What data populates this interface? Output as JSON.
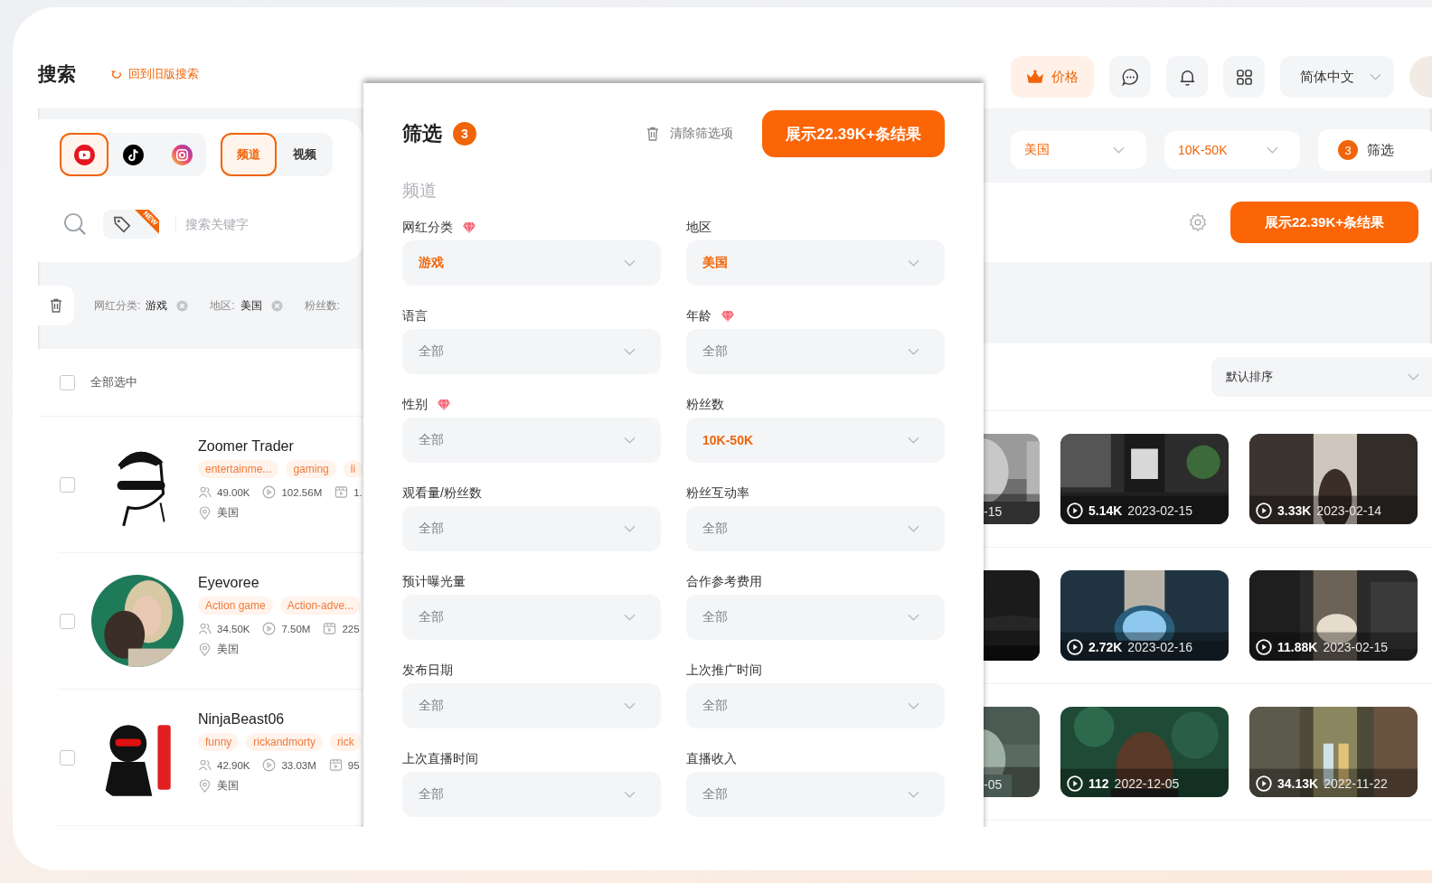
{
  "header": {
    "title": "搜索",
    "back_link": "回到旧版搜索",
    "price_button": "价格",
    "language": "简体中文"
  },
  "platforms": [
    {
      "kind": "youtube",
      "selected": true
    },
    {
      "kind": "tiktok",
      "selected": false
    },
    {
      "kind": "instagram",
      "selected": false
    }
  ],
  "content_types": [
    {
      "label": "频道",
      "selected": true
    },
    {
      "label": "视频",
      "selected": false
    }
  ],
  "search": {
    "tag_badge": "NEW",
    "placeholder": "搜索关键字"
  },
  "quick_filters": [
    {
      "value": "美国"
    },
    {
      "value": "10K-50K"
    }
  ],
  "filter_button": {
    "count": "3",
    "label": "筛选"
  },
  "results_button": "展示22.39K+条结果",
  "active_filters": [
    {
      "label": "网红分类:",
      "value": "游戏"
    },
    {
      "label": "地区:",
      "value": "美国"
    },
    {
      "label": "粉丝数:"
    }
  ],
  "select_all": {
    "label": "全部选中",
    "checked": false
  },
  "sort": "默认排序",
  "creators": [
    {
      "name": "Zoomer Trader",
      "checked": false,
      "tags": [
        "entertainme...",
        "gaming",
        "li"
      ],
      "followers": "49.00K",
      "views": "102.56M",
      "videos": "1.",
      "location": "美国",
      "clips": [
        {
          "kind": "picture",
          "date": "-15"
        },
        {
          "kind": "picture",
          "views": "5.14K",
          "date": "2023-02-15"
        },
        {
          "kind": "picture",
          "views": "3.33K",
          "date": "2023-02-14"
        }
      ]
    },
    {
      "name": "Eyevoree",
      "checked": false,
      "tags": [
        "Action game",
        "Action-adve..."
      ],
      "followers": "34.50K",
      "views": "7.50M",
      "videos": "225",
      "location": "美国",
      "clips": [
        {
          "kind": "picture"
        },
        {
          "kind": "picture",
          "views": "2.72K",
          "date": "2023-02-16"
        },
        {
          "kind": "picture",
          "views": "11.88K",
          "date": "2023-02-15"
        }
      ]
    },
    {
      "name": "NinjaBeast06",
      "checked": false,
      "tags": [
        "funny",
        "rickandmorty",
        "rick"
      ],
      "followers": "42.90K",
      "views": "33.03M",
      "videos": "95",
      "location": "美国",
      "clips": [
        {
          "kind": "picture",
          "date": "-05"
        },
        {
          "kind": "picture",
          "views": "112",
          "date": "2022-12-05"
        },
        {
          "kind": "picture",
          "views": "34.13K",
          "date": "2022-11-22"
        }
      ]
    }
  ],
  "filter_panel": {
    "title": "筛选",
    "count": "3",
    "clear": "清除筛选项",
    "apply": "展示22.39K+条结果",
    "section": "频道",
    "fields": [
      {
        "label": "网红分类",
        "premium": true,
        "value": "游戏",
        "active": true
      },
      {
        "label": "地区",
        "premium": false,
        "value": "美国",
        "active": true
      },
      {
        "label": "语言",
        "premium": false,
        "value": "全部",
        "active": false
      },
      {
        "label": "年龄",
        "premium": true,
        "value": "全部",
        "active": false
      },
      {
        "label": "性别",
        "premium": true,
        "value": "全部",
        "active": false
      },
      {
        "label": "粉丝数",
        "premium": false,
        "value": "10K-50K",
        "active": true
      },
      {
        "label": "观看量/粉丝数",
        "premium": false,
        "value": "全部",
        "active": false
      },
      {
        "label": "粉丝互动率",
        "premium": false,
        "value": "全部",
        "active": false
      },
      {
        "label": "预计曝光量",
        "premium": false,
        "value": "全部",
        "active": false
      },
      {
        "label": "合作参考费用",
        "premium": false,
        "value": "全部",
        "active": false
      },
      {
        "label": "发布日期",
        "premium": false,
        "value": "全部",
        "active": false
      },
      {
        "label": "上次推广时间",
        "premium": false,
        "value": "全部",
        "active": false
      },
      {
        "label": "上次直播时间",
        "premium": false,
        "value": "全部",
        "active": false
      },
      {
        "label": "直播收入",
        "premium": false,
        "value": "全部",
        "active": false
      }
    ]
  }
}
